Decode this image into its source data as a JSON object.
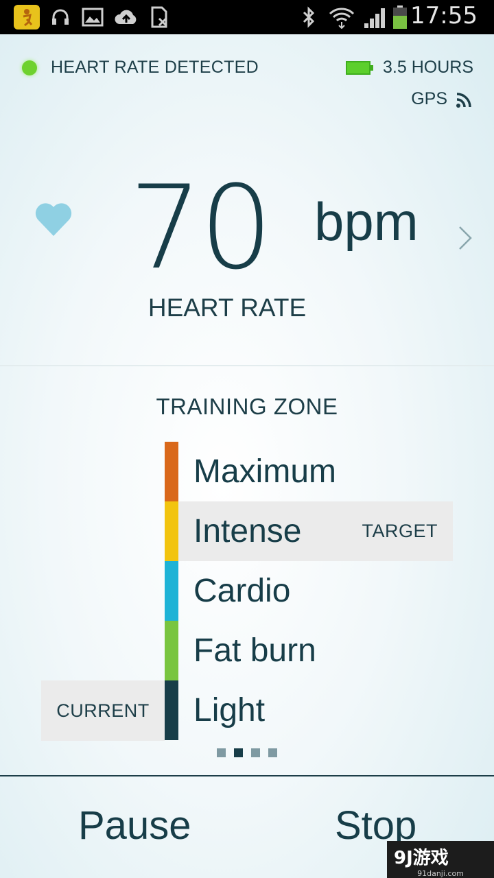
{
  "status_bar": {
    "time": "17:55",
    "app_icon_label": "Jabra",
    "icons": [
      "jabra-app-icon",
      "headphones-icon",
      "image-icon",
      "cloud-upload-icon",
      "sim-icon",
      "bluetooth-icon",
      "wifi-icon",
      "signal-icon",
      "battery-icon"
    ],
    "battery_color": "#7ac142"
  },
  "top": {
    "hr_status": "HEART RATE DETECTED",
    "battery_text": "3.5 HOURS",
    "gps_text": "GPS"
  },
  "heart_rate": {
    "value": "70",
    "unit": "bpm",
    "label": "HEART RATE"
  },
  "training_zone": {
    "title": "TRAINING ZONE",
    "zones": [
      {
        "label": "Maximum",
        "color": "#d9681a"
      },
      {
        "label": "Intense",
        "color": "#f2c40f",
        "tag": "TARGET"
      },
      {
        "label": "Cardio",
        "color": "#1eb3d6"
      },
      {
        "label": "Fat burn",
        "color": "#79c540"
      },
      {
        "label": "Light",
        "color": "#173d48"
      }
    ],
    "current_label": "CURRENT",
    "pager_active_index": 1,
    "pager_count": 4
  },
  "buttons": {
    "pause": "Pause",
    "stop": "Stop"
  },
  "watermark": {
    "brand": "9J游戏",
    "url": "91danji.com"
  },
  "colors": {
    "accent_dark": "#173d48",
    "heart": "#8fd0e3",
    "green_dot": "#6ed12e"
  }
}
